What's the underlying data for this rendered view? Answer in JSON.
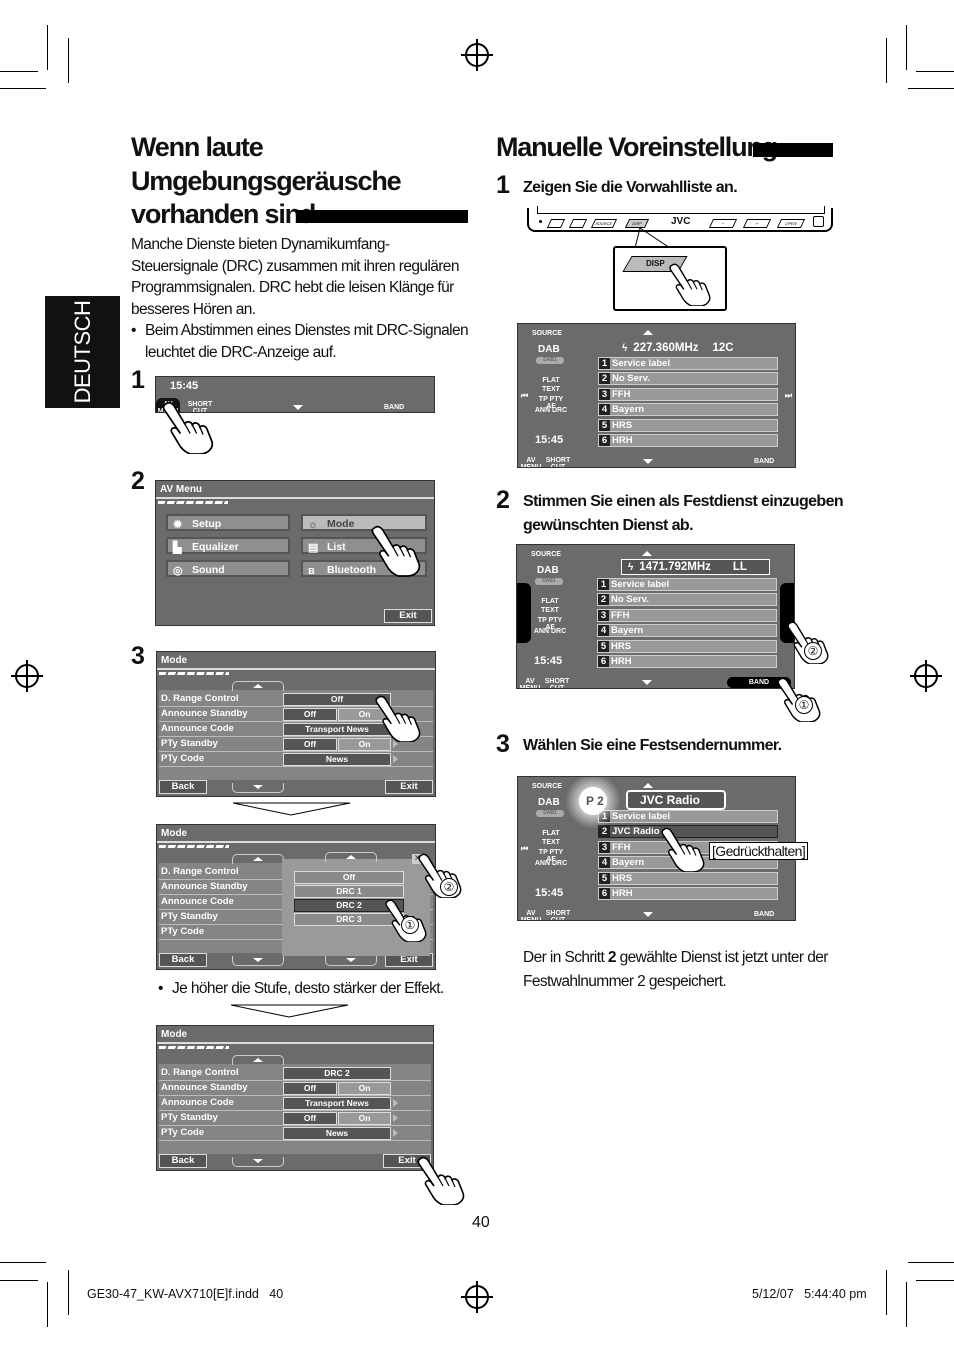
{
  "left": {
    "title_lines": [
      "Wenn laute",
      "Umgebungsgeräusche",
      "vorhanden sind"
    ],
    "intro_lines": [
      "Manche Dienste bieten Dynamikumfang-",
      "Steuersignale (DRC) zusammen mit ihren regulären",
      "Programmsignalen. DRC hebt die leisen Klänge für",
      "besseres Hören an."
    ],
    "bullet_lines": [
      "Beim Abstimmen eines Dienstes mit DRC-Signalen",
      "leuchtet die DRC-Anzeige auf."
    ],
    "side_tab": "DEUTSCH",
    "steps": [
      "1",
      "2",
      "3"
    ],
    "screen1": {
      "clock": "15:45",
      "av_menu": "AV MENU",
      "short_cut": "SHORT CUT",
      "band": "BAND"
    },
    "screen2": {
      "title": "AV Menu",
      "buttons": [
        {
          "label": "Setup",
          "icon": "gear"
        },
        {
          "label": "Mode",
          "icon": "bulb"
        },
        {
          "label": "Equalizer",
          "icon": "equalizer"
        },
        {
          "label": "List",
          "icon": "list"
        },
        {
          "label": "Sound",
          "icon": "sound"
        },
        {
          "label": "Bluetooth",
          "icon": "bluetooth"
        }
      ],
      "exit": "Exit"
    },
    "mode_a": {
      "title": "Mode",
      "rows": [
        {
          "label": "D. Range Control",
          "values": [
            "Off"
          ]
        },
        {
          "label": "Announce Standby",
          "values": [
            "Off",
            "On"
          ]
        },
        {
          "label": "Announce Code",
          "values": [
            "Transport News"
          ]
        },
        {
          "label": "PTy Standby",
          "values": [
            "Off",
            "On"
          ]
        },
        {
          "label": "PTy Code",
          "values": [
            "News"
          ]
        }
      ],
      "back": "Back",
      "exit": "Exit"
    },
    "mode_b": {
      "title": "Mode",
      "rows": [
        {
          "label": "D. Range Control"
        },
        {
          "label": "Announce Standby"
        },
        {
          "label": "Announce Code"
        },
        {
          "label": "PTy Standby"
        },
        {
          "label": "PTy Code"
        }
      ],
      "options": [
        "Off",
        "DRC 1",
        "DRC 2",
        "DRC 3"
      ],
      "selected": "DRC 2",
      "close": "×",
      "back": "Back",
      "exit": "Exit",
      "callouts": [
        "②",
        "①"
      ]
    },
    "effect_note": "Je höher die Stufe, desto stärker der Effekt.",
    "mode_c": {
      "title": "Mode",
      "rows": [
        {
          "label": "D. Range Control",
          "values": [
            "DRC 2"
          ]
        },
        {
          "label": "Announce Standby",
          "values": [
            "Off",
            "On"
          ]
        },
        {
          "label": "Announce Code",
          "values": [
            "Transport News"
          ]
        },
        {
          "label": "PTy Standby",
          "values": [
            "Off",
            "On"
          ]
        },
        {
          "label": "PTy Code",
          "values": [
            "News"
          ]
        }
      ],
      "back": "Back",
      "exit": "Exit"
    }
  },
  "right": {
    "title": "Manuelle Voreinstellung",
    "step1": {
      "num": "1",
      "text": "Zeigen Sie die Vorwahlliste an."
    },
    "device": {
      "brand": "JVC",
      "disp": "DISP",
      "buttons": [
        "SOURCE",
        "DISP",
        "−",
        "+",
        "OPEN"
      ]
    },
    "radio1": {
      "source": "SOURCE",
      "band": "DAB",
      "sub": "DAB1",
      "indicators": [
        "FLAT",
        "TEXT",
        "TP PTY AF",
        "ANN DRC"
      ],
      "clock": "15:45",
      "freq": "227.360MHz",
      "channel": "12C",
      "presets": [
        {
          "num": "1",
          "name": "Service label"
        },
        {
          "num": "2",
          "name": "No Serv."
        },
        {
          "num": "3",
          "name": "FFH"
        },
        {
          "num": "4",
          "name": "Bayern"
        },
        {
          "num": "5",
          "name": "HRS"
        },
        {
          "num": "6",
          "name": "HRH"
        }
      ],
      "av_menu": "AV MENU",
      "short_cut": "SHORT CUT",
      "band_btn": "BAND"
    },
    "step2": {
      "num": "2",
      "text_lines": [
        "Stimmen Sie einen als Festdienst einzugeben",
        "gewünschten Dienst ab."
      ]
    },
    "radio2": {
      "source": "SOURCE",
      "band": "DAB",
      "sub": "DAB1",
      "indicators": [
        "FLAT",
        "TEXT",
        "TP PTY AF",
        "ANN DRC"
      ],
      "clock": "15:45",
      "freq": "1471.792MHz",
      "channel": "LL",
      "presets": [
        {
          "num": "1",
          "name": "Service label"
        },
        {
          "num": "2",
          "name": "No Serv."
        },
        {
          "num": "3",
          "name": "FFH"
        },
        {
          "num": "4",
          "name": "Bayern"
        },
        {
          "num": "5",
          "name": "HRS"
        },
        {
          "num": "6",
          "name": "HRH"
        }
      ],
      "av_menu": "AV MENU",
      "short_cut": "SHORT CUT",
      "band_btn": "BAND",
      "callouts": [
        "②",
        "①"
      ]
    },
    "step3": {
      "num": "3",
      "text": "Wählen Sie eine Festsendernummer."
    },
    "radio3": {
      "source": "SOURCE",
      "band": "DAB",
      "sub": "DAB1",
      "indicators": [
        "FLAT",
        "TEXT",
        "TP PTY AF",
        "ANN DRC"
      ],
      "clock": "15:45",
      "preset_badge": "P 2",
      "station": "JVC Radio",
      "presets": [
        {
          "num": "1",
          "name": "Service label"
        },
        {
          "num": "2",
          "name": "JVC Radio"
        },
        {
          "num": "3",
          "name": "FFH"
        },
        {
          "num": "4",
          "name": "Bayern"
        },
        {
          "num": "5",
          "name": "HRS"
        },
        {
          "num": "6",
          "name": "HRH"
        }
      ],
      "av_menu": "AV MENU",
      "short_cut": "SHORT CUT",
      "band_btn": "BAND",
      "hold_label": "[Gedrückthalten]"
    },
    "result_lines": [
      "Der in Schritt ",
      "2",
      " gewählte Dienst ist jetzt unter der",
      "Festwahlnummer 2 gespeichert."
    ]
  },
  "page_number": "40",
  "footer": {
    "file": "GE30-47_KW-AVX710[E]f.indd   40",
    "date": "5/12/07   5:44:40 pm"
  }
}
